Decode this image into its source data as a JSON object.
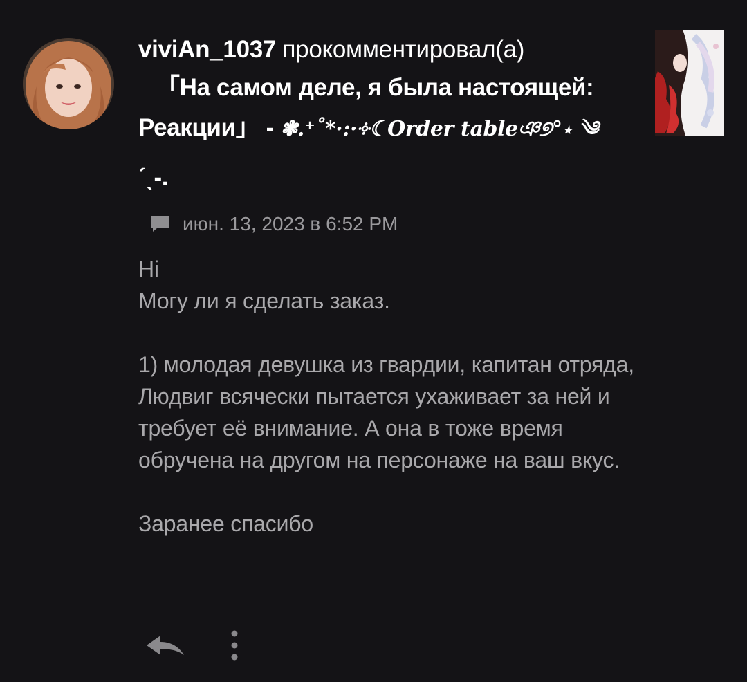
{
  "comment": {
    "username": "viviAn_1037",
    "action_text": "прокомментировал(а)",
    "post_title_line1": "「На самом деле, я была настоящей:",
    "post_title_line2_prefix": "Реакции」 - ",
    "post_title_line2_deco": "❃.⁺˚*·:·༓☾Order table",
    "post_title_line2_suffix": "ঞ୭°⋆ ༄",
    "post_title_line3": "ˊˎ-.",
    "date": "июн. 13, 2023 в 6:52 PM",
    "body": {
      "line_hi": "Hi",
      "line_order": "Могу ли я сделать заказ.",
      "paragraph_1": "1) молодая девушка из гвардии, капитан отряда, Людвиг всячески пытается ухаживает за ней и требует её внимание. А она в тоже время обручена на другом на персонаже на ваш вкус.",
      "closing": "Заранее спасибо"
    }
  },
  "icons": {
    "avatar": "user-avatar",
    "thumbnail": "post-thumbnail",
    "comment": "chat-bubble-icon",
    "reply": "reply-icon",
    "more": "more-vertical-icon"
  },
  "colors": {
    "background": "#141316",
    "primary_text": "#ffffff",
    "secondary_text": "#9a999c",
    "body_text": "#a9a8ab"
  }
}
